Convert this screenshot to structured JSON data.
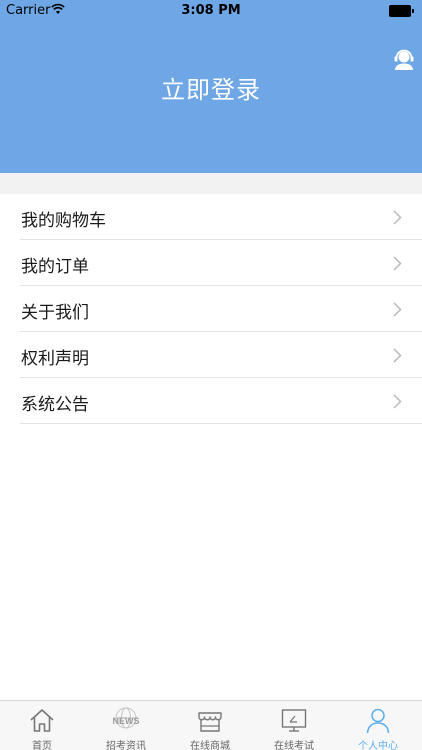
{
  "status_bar": {
    "carrier": "Carrier",
    "time": "3:08 PM"
  },
  "header": {
    "login_label": "立即登录",
    "background_color": "#6ea6e6",
    "right_icon": "customer-service-icon"
  },
  "menu": {
    "items": [
      {
        "label": "我的购物车"
      },
      {
        "label": "我的订单"
      },
      {
        "label": "关于我们"
      },
      {
        "label": "权利声明"
      },
      {
        "label": "系统公告"
      }
    ]
  },
  "tabbar": {
    "active_color": "#5aaef0",
    "tabs": [
      {
        "label": "首页",
        "icon": "home-icon"
      },
      {
        "label": "招考资讯",
        "icon": "news-icon",
        "icon_text": "NEWS"
      },
      {
        "label": "在线商城",
        "icon": "shop-icon"
      },
      {
        "label": "在线考试",
        "icon": "exam-screen-icon"
      },
      {
        "label": "个人中心",
        "icon": "person-icon",
        "active": true
      }
    ]
  }
}
